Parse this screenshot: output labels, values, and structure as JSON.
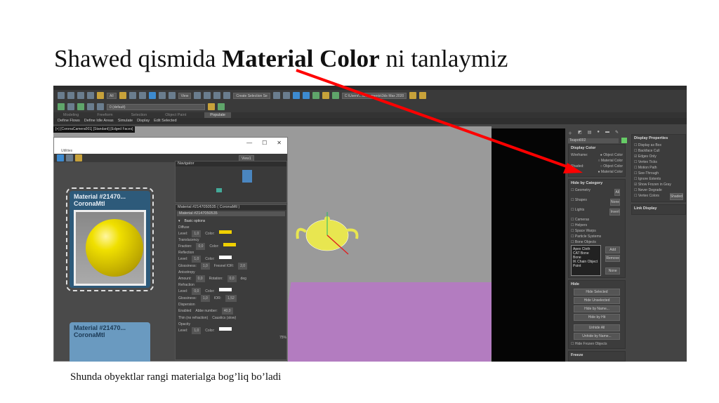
{
  "slide": {
    "title_pre": "Shawed qismida ",
    "title_bold": "Material Color",
    "title_post": " ni tanlaymiz",
    "caption": "Shunda obyektlar rangi materialga bog’liq bo’ladi",
    "arrow_color": "#ff0000"
  },
  "app": {
    "toolbar": {
      "selection_filter": "All",
      "view_dropdown": "View",
      "create_selection_set": "Create Selection Se",
      "layer": "0 (default)",
      "project_path": "C:\\Users\\...\\Documents\\3ds Max 2020"
    },
    "ribbon_tabs": [
      "Modeling",
      "Freeform",
      "Selection",
      "Object Paint",
      "Populate"
    ],
    "ribbon_active": "Populate",
    "ribbon_sub": [
      "Define Flows",
      "Define Idle Areas",
      "Simulate",
      "Display",
      "Edit Selected"
    ],
    "viewport_label": "[+] [CoronaCamera001] [Standard] [Edged Faces]",
    "command_panel": {
      "object_name": "Teapot002",
      "object_color": "#66cc66",
      "display_color": {
        "title": "Display Color",
        "wireframe_label": "Wireframe:",
        "shaded_label": "Shaded:",
        "object_color": "Object Color",
        "material_color": "Material Color",
        "wireframe_selected": "Object Color",
        "shaded_selected": "Material Color"
      },
      "hide_by_category": {
        "title": "Hide by Category",
        "items": [
          "Geometry",
          "Shapes",
          "Lights",
          "Cameras",
          "Helpers",
          "Space Warps",
          "Particle Systems",
          "Bone Objects"
        ],
        "buttons": [
          "All",
          "None",
          "Invert"
        ],
        "list": [
          "Apex Cloth",
          "CAT Bone",
          "Bone",
          "IK Chain Object",
          "Point"
        ],
        "list_buttons": [
          "Add",
          "Remove",
          "None"
        ]
      },
      "hide": {
        "title": "Hide",
        "buttons": [
          "Hide Selected",
          "Hide Unselected",
          "Hide by Name...",
          "Hide by Hit",
          "Unhide All",
          "Unhide by Name..."
        ],
        "checkbox": "Hide Frozen Objects"
      },
      "freeze_title": "Freeze",
      "display_properties": {
        "title": "Display Properties",
        "items": [
          {
            "label": "Display as Box",
            "checked": false
          },
          {
            "label": "Backface Cull",
            "checked": false
          },
          {
            "label": "Edges Only",
            "checked": true
          },
          {
            "label": "Vertex Ticks",
            "checked": false
          },
          {
            "label": "Motion Path",
            "checked": false
          },
          {
            "label": "See-Through",
            "checked": false
          },
          {
            "label": "Ignore Extents",
            "checked": false
          },
          {
            "label": "Show Frozen in Gray",
            "checked": true
          },
          {
            "label": "Never Degrade",
            "checked": false
          },
          {
            "label": "Vertex Colors",
            "checked": false
          }
        ],
        "shaded_button": "Shaded"
      },
      "link_display": "Link Display"
    },
    "slate": {
      "menu": "Utilities",
      "view_tab": "View1",
      "navigator": "Navigator",
      "nodes": [
        {
          "name": "Material #21470...",
          "type": "CoronaMtl"
        },
        {
          "name": "Material #21470...",
          "type": "CoronaMtl"
        }
      ],
      "params_title": "Material #2147050535 ( CoronaMtl )",
      "params_name": "Material #2147050535",
      "basic_options": "Basic options",
      "sections": [
        {
          "title": "Diffuse",
          "rows": [
            {
              "label": "Level:",
              "value": "1,0",
              "color_label": "Color:",
              "color": "#f0d000"
            }
          ]
        },
        {
          "title": "Translucency",
          "rows": [
            {
              "label": "Fraction:",
              "value": "0,0",
              "color_label": "Color:",
              "color": "#f0d000"
            }
          ]
        },
        {
          "title": "Reflection",
          "rows": [
            {
              "label": "Level:",
              "value": "1,0",
              "color_label": "Color:",
              "color": "#ffffff"
            },
            {
              "label": "Glossiness:",
              "value": "1,0",
              "extra_label": "Fresnel IOR:",
              "extra_value": "2,0"
            }
          ]
        },
        {
          "title": "Anisotropy",
          "rows": [
            {
              "label": "Amount:",
              "value": "0,0",
              "extra_label": "Rotation:",
              "extra_value": "0,0",
              "unit": "deg"
            }
          ]
        },
        {
          "title": "Refraction",
          "rows": [
            {
              "label": "Level:",
              "value": "0,0",
              "color_label": "Color:",
              "color": "#ffffff"
            },
            {
              "label": "Glossiness:",
              "value": "1,0",
              "extra_label": "IOR:",
              "extra_value": "1,52"
            }
          ]
        },
        {
          "title": "Dispersion",
          "rows": [
            {
              "label": "Enabled",
              "extra_label": "Abbe number:",
              "extra_value": "40,0"
            }
          ]
        },
        {
          "title": "",
          "rows": [
            {
              "label": "Thin (no refraction)",
              "extra_label": "Caustics (slow)"
            }
          ]
        },
        {
          "title": "Opacity",
          "rows": [
            {
              "label": "Level:",
              "value": "1,0",
              "color_label": "Color:",
              "color": "#ffffff"
            }
          ]
        }
      ],
      "zoom": "75%"
    }
  }
}
